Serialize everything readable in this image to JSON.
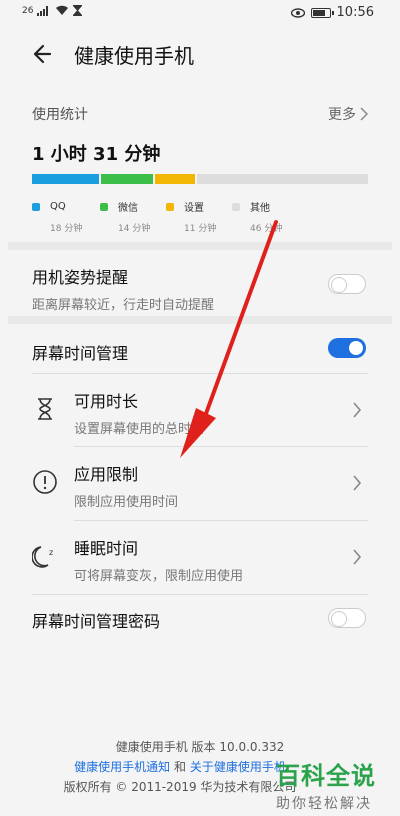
{
  "status": {
    "left_text": "26",
    "time": "10:56",
    "icons": [
      "signal-icon",
      "wifi-icon",
      "hourglass-icon",
      "eye-icon",
      "battery-icon"
    ]
  },
  "appbar": {
    "title": "健康使用手机"
  },
  "usage": {
    "heading": "使用统计",
    "more": "更多",
    "total": "1 小时 31 分钟",
    "items": [
      {
        "name": "QQ",
        "time": "18 分钟",
        "minutes": 18,
        "color": "#1a9ee0"
      },
      {
        "name": "微信",
        "time": "14 分钟",
        "minutes": 14,
        "color": "#3cbf4a"
      },
      {
        "name": "设置",
        "time": "11 分钟",
        "minutes": 11,
        "color": "#f2b705"
      },
      {
        "name": "其他",
        "time": "46 分钟",
        "minutes": 46,
        "color": "#dddddd"
      }
    ]
  },
  "posture": {
    "label": "用机姿势提醒",
    "sub": "距离屏幕较近，行走时自动提醒",
    "enabled": false
  },
  "screen_time": {
    "label": "屏幕时间管理",
    "enabled": true
  },
  "items": [
    {
      "label": "可用时长",
      "sub": "设置屏幕使用的总时间",
      "icon": "hourglass-icon"
    },
    {
      "label": "应用限制",
      "sub": "限制应用使用时间",
      "icon": "alert-circle-icon"
    },
    {
      "label": "睡眠时间",
      "sub": "可将屏幕变灰，限制应用使用",
      "icon": "moon-icon"
    }
  ],
  "password": {
    "label": "屏幕时间管理密码",
    "enabled": false
  },
  "footer": {
    "version": "健康使用手机 版本 10.0.0.332",
    "link1": "健康使用手机通知",
    "and": "和",
    "link2": "关于健康使用手机",
    "copyright": "版权所有 © 2011-2019 华为技术有限公司"
  },
  "watermark": {
    "main": "百科全说",
    "sub": "助你轻松解决"
  },
  "annotation": {
    "color": "#e0211b"
  }
}
